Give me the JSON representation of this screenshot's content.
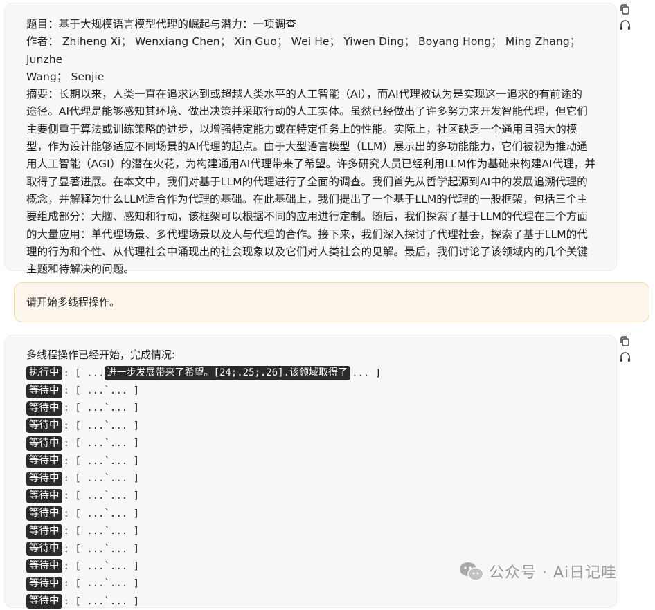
{
  "paper_message": {
    "title_line": "题目：基于大规模语言模型代理的崛起与潜力：一项调查",
    "authors_line1": "作者： Zhiheng Xi； Wenxiang Chen； Xin Guo； Wei He； Yiwen Ding； Boyang Hong； Ming Zhang； Junzhe",
    "authors_line2": "Wang； Senjie",
    "abstract_lines": [
      "摘要：长期以来，人类一直在追求达到或超越人类水平的人工智能（AI），而AI代理被认为是实现这一追求的有前途的",
      "途径。AI代理是能够感知其环境、做出决策并采取行动的人工实体。虽然已经做出了许多努力来开发智能代理，但它们",
      "主要侧重于算法或训练策略的进步，以增强特定能力或在特定任务上的性能。实际上，社区缺乏一个通用且强大的模",
      "型，作为设计能够适应不同场景的AI代理的起点。由于大型语言模型（LLM）展示出的多功能能力，它们被视为推动通",
      "用人工智能（AGI）的潜在火花，为构建通用AI代理带来了希望。许多研究人员已经利用LLM作为基础来构建AI代理，并",
      "取得了显著进展。在本文中，我们对基于LLM的代理进行了全面的调查。我们首先从哲学起源到AI中的发展追溯代理的",
      "概念，并解释为什么LLM适合作为代理的基础。在此基础上，我们提出了一个基于LLM的代理的一般框架，包括三个主",
      "要组成部分：大脑、感知和行动，该框架可以根据不同的应用进行定制。随后，我们探索了基于LLM的代理在三个方面",
      "的大量应用：单代理场景、多代理场景以及人与代理的合作。接下来，我们深入探讨了代理社会，探索了基于LLM的代",
      "理的行为和个性、从代理社会中涌现出的社会现象以及它们对人类社会的见解。最后，我们讨论了该领域内的几个关键",
      "主题和待解决的问题。"
    ]
  },
  "user_message": {
    "text": "请开始多线程操作。"
  },
  "status_message": {
    "title": "多线程操作已经开始，完成情况:",
    "running": {
      "badge": "执行中",
      "prefix": ": [ ...",
      "snippet": "进一步发展带来了希望。[24;.25;.26].该领域取得了",
      "suffix": "... ]"
    },
    "waiting": [
      {
        "badge": "等待中",
        "text": ": [ ...`... ]"
      },
      {
        "badge": "等待中",
        "text": ": [ ...`... ]"
      },
      {
        "badge": "等待中",
        "text": ": [ ...`... ]"
      },
      {
        "badge": "等待中",
        "text": ": [ ...`... ]"
      },
      {
        "badge": "等待中",
        "text": ": [ ...`... ]"
      },
      {
        "badge": "等待中",
        "text": ": [ ...`... ]"
      },
      {
        "badge": "等待中",
        "text": ": [ ...`... ]"
      },
      {
        "badge": "等待中",
        "text": ": [ ...`... ]"
      },
      {
        "badge": "等待中",
        "text": ": [ ...`... ]"
      },
      {
        "badge": "等待中",
        "text": ": [ ...`... ]"
      },
      {
        "badge": "等待中",
        "text": ": [ ...`... ]"
      },
      {
        "badge": "等待中",
        "text": ": [ ...`... ]"
      },
      {
        "badge": "等待中",
        "text": ": [ ...`... ]"
      }
    ]
  },
  "icons": [
    "copy-icon",
    "headphones-icon",
    "wechat-icon"
  ],
  "watermark": {
    "text": "公众号 · Ai日记哇"
  },
  "colors": {
    "badge_bg": "#2b2b2b",
    "user_bubble_bg": "#fdf6ec",
    "user_bubble_border": "#f5d9a8",
    "assistant_bubble_bg": "#f7f7f8"
  }
}
